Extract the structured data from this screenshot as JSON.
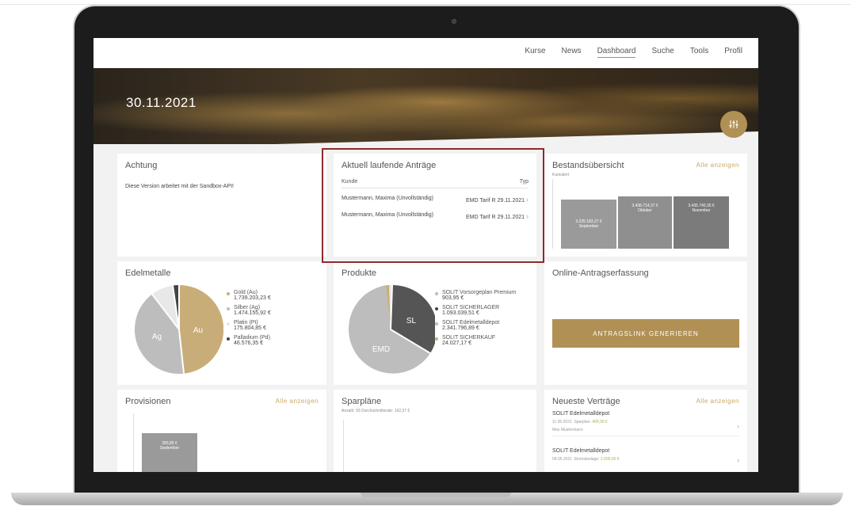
{
  "nav": {
    "items": [
      {
        "label": "Kurse"
      },
      {
        "label": "News"
      },
      {
        "label": "Dashboard"
      },
      {
        "label": "Suche"
      },
      {
        "label": "Tools"
      },
      {
        "label": "Profil"
      }
    ]
  },
  "hero": {
    "date": "30.11.2021",
    "settings_icon": "sliders-icon"
  },
  "achtung": {
    "title": "Achtung",
    "text": "Diese Version arbeitet mit der Sandbox-API!"
  },
  "antraege": {
    "title": "Aktuell laufende Anträge",
    "col_kunde": "Kunde",
    "col_typ": "Typ",
    "rows": [
      {
        "kunde": "Mustermann, Maxima (Unvollständig)",
        "typ": "EMD Tarif R 29.11.2021"
      },
      {
        "kunde": "Mustermann, Maxima (Unvollständig)",
        "typ": "EMD Tarif R 29.11.2021"
      }
    ]
  },
  "bestand": {
    "title": "Bestandsübersicht",
    "link": "Alle anzeigen",
    "subtitle": "Kumuliert",
    "bars": [
      {
        "value": "3.225.183,27 €",
        "month": "September",
        "level": 0.72
      },
      {
        "value": "3.438.714,37 €",
        "month": "Oktober",
        "level": 0.77
      },
      {
        "value": "3.435.740,35 €",
        "month": "November",
        "level": 0.77
      }
    ]
  },
  "edelmetalle": {
    "title": "Edelmetalle",
    "slice_labels": [
      "Au",
      "Ag"
    ],
    "legend": [
      {
        "name": "Gold (Au)",
        "value": "1.739.203,23 €",
        "color": "#c9ad78"
      },
      {
        "name": "Silber (Ag)",
        "value": "1.474.155,92 €",
        "color": "#bdbdbd"
      },
      {
        "name": "Platin (Pt)",
        "value": "175.804,85 €",
        "color": "#e8e8e8"
      },
      {
        "name": "Palladium (Pd)",
        "value": "46.576,35 €",
        "color": "#444444"
      }
    ]
  },
  "produkte": {
    "title": "Produkte",
    "slice_labels": [
      "SL",
      "EMD"
    ],
    "legend": [
      {
        "name": "SOLIT Vorsorgeplan Premium",
        "value": "903,95 €",
        "color": "#bdbdbd"
      },
      {
        "name": "SOLIT SICHERLAGER",
        "value": "1.093.039,51 €",
        "color": "#444444"
      },
      {
        "name": "SOLIT Edelmetalldepot",
        "value": "2.341.796,89 €",
        "color": "#bdbdbd"
      },
      {
        "name": "SOLIT SICHERKAUF",
        "value": "24.027,17 €",
        "color": "#c9ad78"
      }
    ]
  },
  "online": {
    "title": "Online-Antragserfassung",
    "button": "ANTRAGSLINK GENERIEREN"
  },
  "provisionen": {
    "title": "Provisionen",
    "link": "Alle anzeigen",
    "bar": {
      "value": "285,85 €",
      "month": "September"
    }
  },
  "sparplaene": {
    "title": "Sparpläne",
    "subtitle": "Anzahl: 93   Durchschnittsrate: 162,37 €"
  },
  "vertraege": {
    "title": "Neueste Verträge",
    "link": "Alle anzeigen",
    "items": [
      {
        "title": "SOLIT Edelmetalldepot",
        "date": "11.05.2021",
        "kind": "Sparplan:",
        "amount": "400,00 €",
        "person": "Max Mustermann"
      },
      {
        "title": "SOLIT Edelmetalldepot",
        "date": "04.05.2021",
        "kind": "Einmalanlage:",
        "amount": "2.000,00 €",
        "person": ""
      }
    ]
  }
}
